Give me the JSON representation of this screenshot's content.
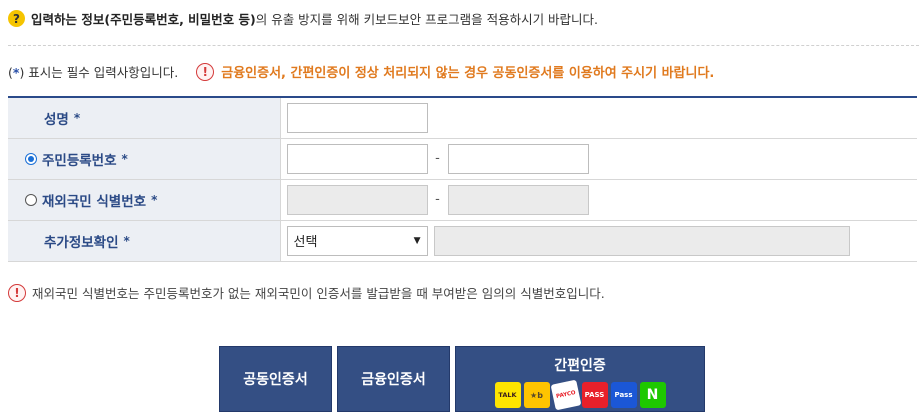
{
  "notice": {
    "icon": "question-icon",
    "icon_glyph": "?",
    "bold": "입력하는 정보(주민등록번호, 비밀번호 등)",
    "rest": "의 유출 방지를 위해 키보드보안 프로그램을 적용하시기 바랍니다."
  },
  "required_note": {
    "open": "(",
    "star": "*",
    "close": ")",
    "text": " 표시는 필수 입력사항입니다."
  },
  "warning": {
    "icon_glyph": "!",
    "text": "금융인증서, 간편인증이 정상 처리되지 않는 경우 공동인증서를 이용하여 주시기 바랍니다."
  },
  "form": {
    "name_label": "성명",
    "rrn_label": "주민등록번호",
    "foreign_label": "재외국민 식별번호",
    "extra_label": "추가정보확인",
    "required_mark": "*",
    "dash": "-",
    "extra_select_value": "선택",
    "select_arrow": "▼",
    "rrn_selected": true
  },
  "info": {
    "icon_glyph": "!",
    "text": "재외국민 식별번호는 주민등록번호가 없는 재외국민이 인증서를 발급받을 때 부여받은 임의의 식별번호입니다."
  },
  "buttons": {
    "joint_cert": "공동인증서",
    "financial_cert": "금융인증서",
    "simple_auth": "간편인증",
    "logos": [
      {
        "name": "kakao-talk-logo",
        "text": "TALK"
      },
      {
        "name": "kb-logo",
        "text": "★b"
      },
      {
        "name": "payco-logo",
        "text": "PAYCO"
      },
      {
        "name": "pass-logo",
        "text": "PASS"
      },
      {
        "name": "samsung-pass-logo",
        "text": "Pass"
      },
      {
        "name": "naver-logo",
        "text": "N"
      }
    ]
  },
  "colors": {
    "accent": "#344f84",
    "label": "#2b4a86",
    "warning": "#e07a1f",
    "alert": "#d43a3a"
  }
}
